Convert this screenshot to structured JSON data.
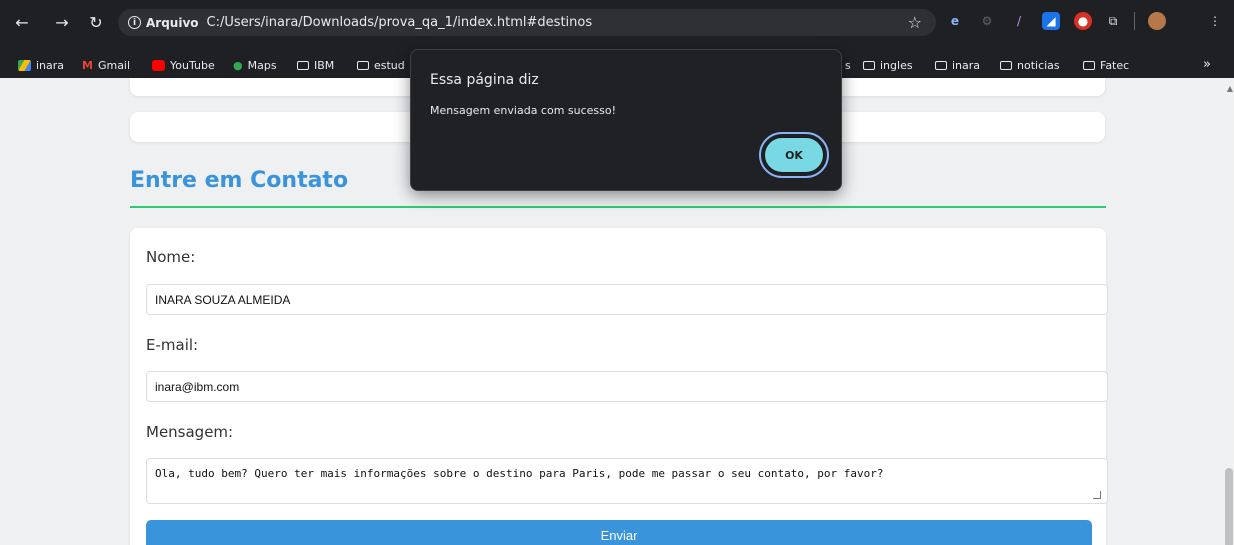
{
  "browser": {
    "address": {
      "scheme_label": "Arquivo",
      "url": "C:/Users/inara/Downloads/prova_qa_1/index.html#destinos"
    },
    "bookmarks": [
      {
        "label": "inara"
      },
      {
        "label": "Gmail"
      },
      {
        "label": "YouTube"
      },
      {
        "label": "Maps"
      },
      {
        "label": "IBM"
      },
      {
        "label": "estud"
      },
      {
        "label": "s"
      },
      {
        "label": "ingles"
      },
      {
        "label": "inara"
      },
      {
        "label": "noticias"
      },
      {
        "label": "Fatec"
      }
    ],
    "overflow_label": "»"
  },
  "page": {
    "section_title": "Entre em Contato",
    "form": {
      "name_label": "Nome:",
      "name_value": "INARA SOUZA ALMEIDA",
      "email_label": "E-mail:",
      "email_value": "inara@ibm.com",
      "message_label": "Mensagem:",
      "message_value": "Ola, tudo bem? Quero ter mais informações sobre o destino para Paris, pode me passar o seu contato, por favor?",
      "submit_label": "Enviar"
    }
  },
  "dialog": {
    "title": "Essa página diz",
    "message": "Mensagem enviada com sucesso!",
    "ok_label": "OK"
  },
  "colors": {
    "accent": "#3a94db",
    "divider": "#2ecc71",
    "ok_button": "#78d9e4"
  },
  "icons": [
    "back-arrow-icon",
    "forward-arrow-icon",
    "reload-icon",
    "info-icon",
    "star-icon",
    "extensions-icon",
    "profile-icon",
    "menu-icon"
  ]
}
